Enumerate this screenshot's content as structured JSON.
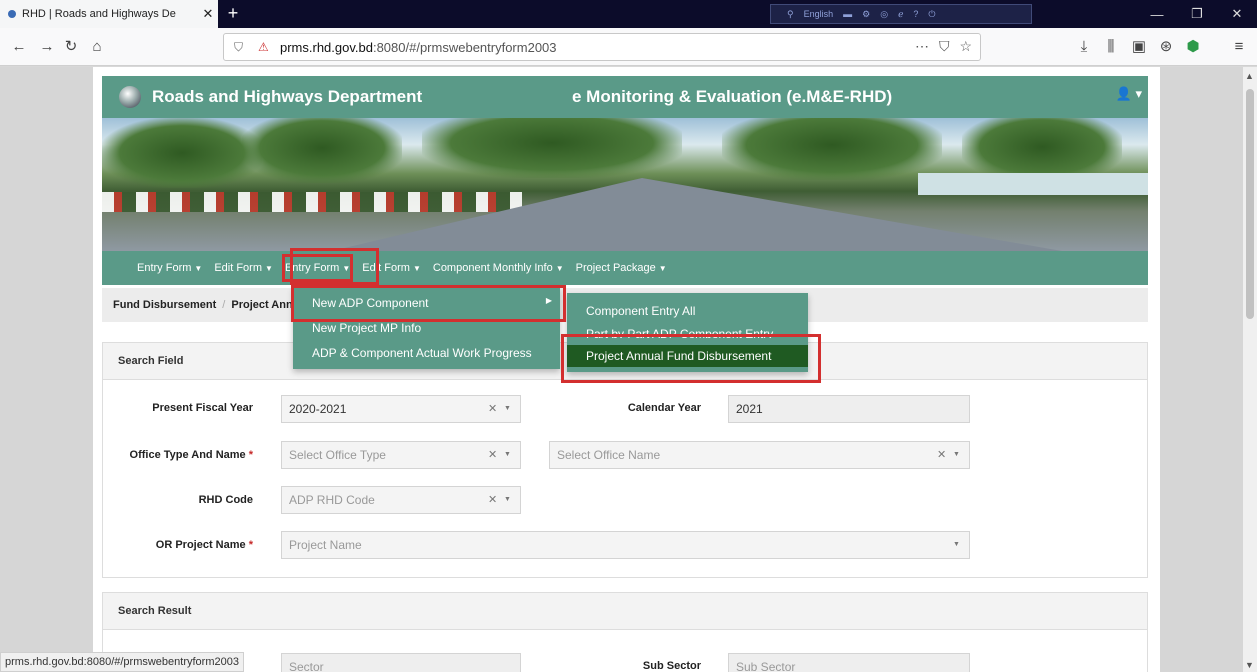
{
  "browser": {
    "tab_title": "RHD | Roads and Highways De",
    "tab_close": "✕",
    "new_tab": "+",
    "tray_lang": "English",
    "url_host": "prms.rhd.gov.bd",
    "url_rest": ":8080/#/prmswebentryform2003",
    "url_actions": [
      "⋯",
      "☆"
    ],
    "window_buttons": [
      "—",
      "❐",
      "✕"
    ],
    "status_url": "prms.rhd.gov.bd:8080/#/prmswebentryform2003"
  },
  "site": {
    "name": "Roads and Highways Department",
    "subtitle": "e Monitoring & Evaluation (e.M&E-RHD)",
    "user_icon": "👤 ▾"
  },
  "menu": {
    "items": [
      {
        "label": "Entry Form"
      },
      {
        "label": "Edit Form"
      },
      {
        "label": "Entry Form"
      },
      {
        "label": "Edit Form"
      },
      {
        "label": "Component Monthly Info"
      },
      {
        "label": "Project Package"
      }
    ],
    "caret": "▼"
  },
  "breadcrumb": {
    "first": "Fund Disbursement",
    "second": "Project Ann"
  },
  "dropdown_l1": {
    "items": [
      "New ADP Component",
      "New Project MP Info",
      "ADP & Component Actual Work Progress"
    ],
    "submenu_caret": "▶"
  },
  "dropdown_l2": {
    "items": [
      "Component Entry All",
      "Part by Part ADP Component Entry",
      "Project Annual Fund Disbursement"
    ]
  },
  "search": {
    "heading": "Search Field",
    "fiscal_year_label": "Present Fiscal Year",
    "fiscal_year_value": "2020-2021",
    "calendar_year_label": "Calendar Year",
    "calendar_year_value": "2021",
    "office_label": "Office Type And Name",
    "office_type_placeholder": "Select Office Type",
    "office_name_placeholder": "Select Office Name",
    "rhd_code_label": "RHD Code",
    "rhd_code_placeholder": "ADP RHD Code",
    "project_label": "OR Project Name",
    "project_placeholder": "Project Name",
    "required_mark": "*",
    "clear": "✕",
    "arrow": "▼"
  },
  "result": {
    "heading": "Search Result",
    "sector_placeholder": "Sector",
    "sub_sector_label": "Sub Sector",
    "sub_sector_placeholder": "Sub Sector"
  },
  "colors": {
    "brand_teal": "#5a9a88",
    "highlight_green": "#1f5a22",
    "annotation_red": "#d32f2f"
  }
}
